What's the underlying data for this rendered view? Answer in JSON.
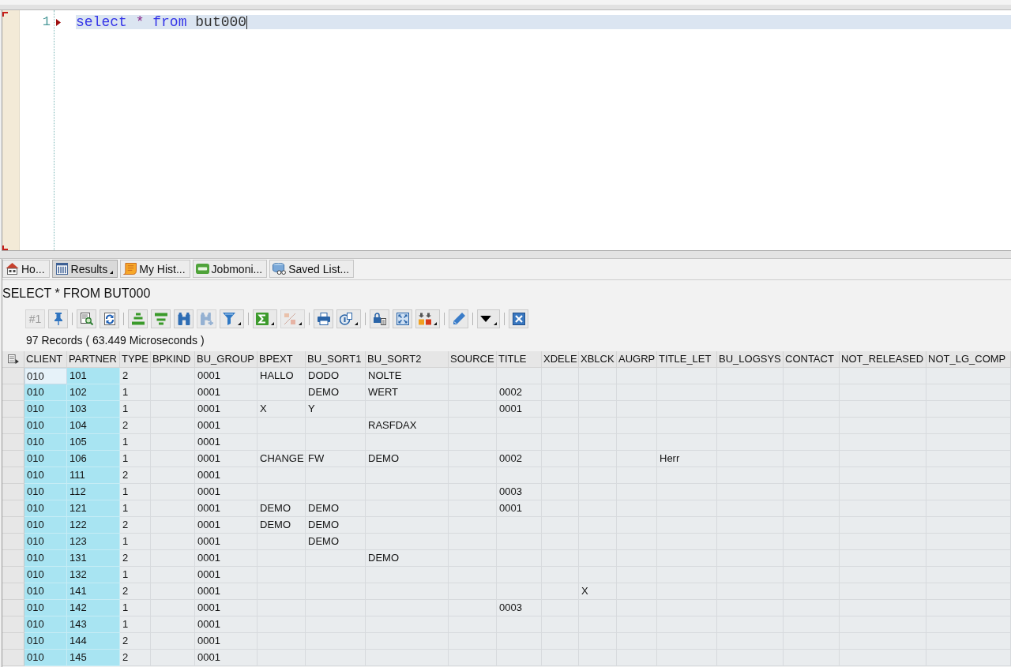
{
  "editor": {
    "lines": [
      {
        "number": "1",
        "current": true,
        "cursor": true,
        "tokens": [
          {
            "text": "select",
            "kind": "keyword"
          },
          {
            "text": "*",
            "kind": "operator"
          },
          {
            "text": "from",
            "kind": "keyword"
          },
          {
            "text": "but000",
            "kind": "name"
          }
        ]
      }
    ]
  },
  "tabs": [
    {
      "label": "Ho...",
      "selected": false,
      "dropdown": false
    },
    {
      "label": "Results",
      "selected": true,
      "dropdown": true
    },
    {
      "label": "My Hist...",
      "selected": false,
      "dropdown": false
    },
    {
      "label": "Jobmoni...",
      "selected": false,
      "dropdown": false
    },
    {
      "label": "Saved List...",
      "selected": false,
      "dropdown": false
    }
  ],
  "results": {
    "title": "SELECT * FROM BUT000",
    "summary": "97 Records ( 63.449 Microseconds )"
  },
  "toolbar": {
    "groups": [
      [
        {
          "kind": "label",
          "label": "#1",
          "disabled": true,
          "dropdown": false
        },
        {
          "kind": "icon",
          "disabled": false,
          "dropdown": false
        }
      ],
      [
        {
          "kind": "icon",
          "disabled": false,
          "dropdown": false
        },
        {
          "kind": "icon",
          "disabled": false,
          "dropdown": false
        }
      ],
      [
        {
          "kind": "icon",
          "disabled": false,
          "dropdown": false
        },
        {
          "kind": "icon",
          "disabled": false,
          "dropdown": false
        },
        {
          "kind": "icon",
          "disabled": false,
          "dropdown": false
        },
        {
          "kind": "icon",
          "disabled": true,
          "dropdown": false
        },
        {
          "kind": "icon",
          "disabled": false,
          "dropdown": true
        }
      ],
      [
        {
          "kind": "icon",
          "disabled": false,
          "dropdown": true
        },
        {
          "kind": "icon",
          "disabled": true,
          "dropdown": true
        }
      ],
      [
        {
          "kind": "icon",
          "disabled": false,
          "dropdown": false
        },
        {
          "kind": "icon",
          "disabled": false,
          "dropdown": true
        }
      ],
      [
        {
          "kind": "icon",
          "disabled": false,
          "dropdown": false
        },
        {
          "kind": "icon",
          "disabled": false,
          "dropdown": false
        },
        {
          "kind": "icon",
          "disabled": false,
          "dropdown": true
        }
      ],
      [
        {
          "kind": "icon",
          "disabled": false,
          "dropdown": false
        }
      ],
      [
        {
          "kind": "icon",
          "disabled": false,
          "dropdown": true
        }
      ],
      [
        {
          "kind": "icon",
          "disabled": false,
          "dropdown": false
        }
      ]
    ]
  },
  "table": {
    "columns": [
      {
        "label": "CLIENT",
        "key": true
      },
      {
        "label": "PARTNER",
        "key": true
      },
      {
        "label": "TYPE",
        "key": false
      },
      {
        "label": "BPKIND",
        "key": false
      },
      {
        "label": "BU_GROUP",
        "key": false
      },
      {
        "label": "BPEXT",
        "key": false
      },
      {
        "label": "BU_SORT1",
        "key": false
      },
      {
        "label": "BU_SORT2",
        "key": false
      },
      {
        "label": "SOURCE",
        "key": false
      },
      {
        "label": "TITLE",
        "key": false
      },
      {
        "label": "XDELE",
        "key": false
      },
      {
        "label": "XBLCK",
        "key": false
      },
      {
        "label": "AUGRP",
        "key": false
      },
      {
        "label": "TITLE_LET",
        "key": false
      },
      {
        "label": "BU_LOGSYS",
        "key": false
      },
      {
        "label": "CONTACT",
        "key": false
      },
      {
        "label": "NOT_RELEASED",
        "key": false
      },
      {
        "label": "NOT_LG_COMP",
        "key": false
      }
    ],
    "rows": [
      {
        "current": true,
        "cells": [
          "010",
          "101",
          "2",
          null,
          "0001",
          "HALLO",
          "DODO",
          "NOLTE"
        ]
      },
      {
        "current": false,
        "cells": [
          "010",
          "102",
          "1",
          null,
          "0001",
          null,
          "DEMO",
          "WERT",
          null,
          "0002"
        ]
      },
      {
        "current": false,
        "cells": [
          "010",
          "103",
          "1",
          null,
          "0001",
          "X",
          "Y",
          null,
          null,
          "0001"
        ]
      },
      {
        "current": false,
        "cells": [
          "010",
          "104",
          "2",
          null,
          "0001",
          null,
          null,
          "RASFDAX"
        ]
      },
      {
        "current": false,
        "cells": [
          "010",
          "105",
          "1",
          null,
          "0001"
        ]
      },
      {
        "current": false,
        "cells": [
          "010",
          "106",
          "1",
          null,
          "0001",
          "CHANGE",
          "FW",
          "DEMO",
          null,
          "0002",
          null,
          null,
          null,
          "Herr"
        ]
      },
      {
        "current": false,
        "cells": [
          "010",
          "111",
          "2",
          null,
          "0001"
        ]
      },
      {
        "current": false,
        "cells": [
          "010",
          "112",
          "1",
          null,
          "0001",
          null,
          null,
          null,
          null,
          "0003"
        ]
      },
      {
        "current": false,
        "cells": [
          "010",
          "121",
          "1",
          null,
          "0001",
          "DEMO",
          "DEMO",
          null,
          null,
          "0001"
        ]
      },
      {
        "current": false,
        "cells": [
          "010",
          "122",
          "2",
          null,
          "0001",
          "DEMO",
          "DEMO"
        ]
      },
      {
        "current": false,
        "cells": [
          "010",
          "123",
          "1",
          null,
          "0001",
          null,
          "DEMO"
        ]
      },
      {
        "current": false,
        "cells": [
          "010",
          "131",
          "2",
          null,
          "0001",
          null,
          null,
          "DEMO"
        ]
      },
      {
        "current": false,
        "cells": [
          "010",
          "132",
          "1",
          null,
          "0001"
        ]
      },
      {
        "current": false,
        "cells": [
          "010",
          "141",
          "2",
          null,
          "0001",
          null,
          null,
          null,
          null,
          null,
          null,
          "X"
        ]
      },
      {
        "current": false,
        "cells": [
          "010",
          "142",
          "1",
          null,
          "0001",
          null,
          null,
          null,
          null,
          "0003"
        ]
      },
      {
        "current": false,
        "cells": [
          "010",
          "143",
          "1",
          null,
          "0001"
        ]
      },
      {
        "current": false,
        "cells": [
          "010",
          "144",
          "2",
          null,
          "0001"
        ]
      },
      {
        "current": false,
        "cells": [
          "010",
          "145",
          "2",
          null,
          "0001"
        ]
      }
    ]
  }
}
